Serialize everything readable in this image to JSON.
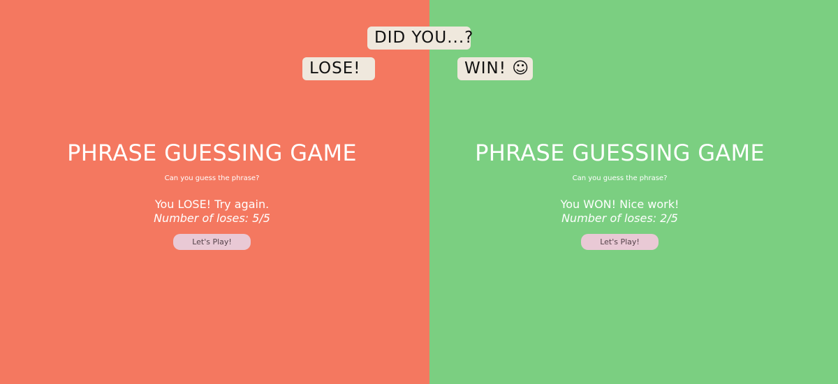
{
  "banner": {
    "question": "DID YOU...?",
    "lose_label": "LOSE!",
    "win_label": "WIN! ☺"
  },
  "colors": {
    "lose_background": "#f47860",
    "win_background": "#7bcf81",
    "tag_background": "#efe8dd",
    "button_background": "#e9c9d5"
  },
  "lose_panel": {
    "title": "PHRASE GUESSING GAME",
    "subtitle": "Can you guess the phrase?",
    "result": "You LOSE! Try again.",
    "losses": "Number of loses: 5/5",
    "button_label": "Let's Play!"
  },
  "win_panel": {
    "title": "PHRASE GUESSING GAME",
    "subtitle": "Can you guess the phrase?",
    "result": "You WON! Nice work!",
    "losses": "Number of loses: 2/5",
    "button_label": "Let's Play!"
  }
}
